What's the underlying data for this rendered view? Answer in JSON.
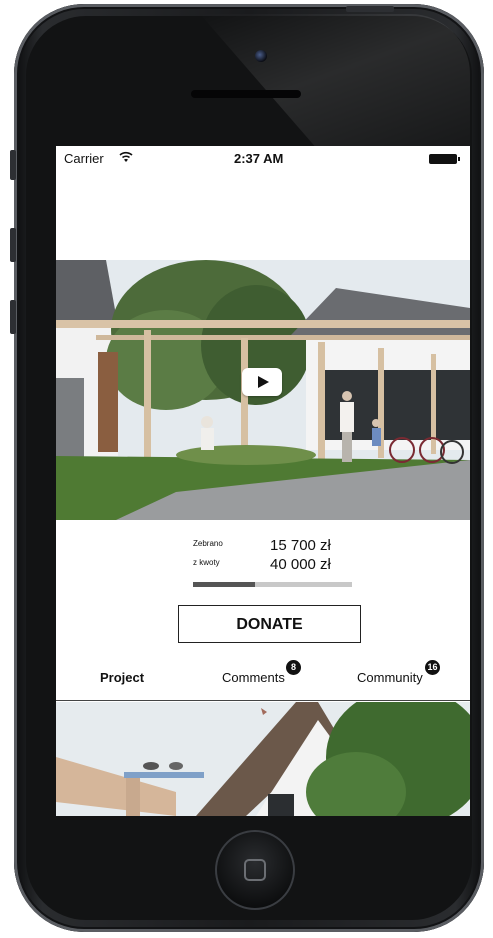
{
  "status_bar": {
    "carrier": "Carrier",
    "time": "2:37 AM"
  },
  "hero": {
    "play_icon": "play-icon"
  },
  "funding": {
    "raised_label": "Zebrano",
    "raised_amount": "15 700 zł",
    "goal_label": "z kwoty",
    "goal_amount": "40 000 zł",
    "progress_fraction": 0.39
  },
  "donate": {
    "label": "DONATE"
  },
  "tabs": [
    {
      "label": "Project",
      "active": true
    },
    {
      "label": "Comments",
      "badge": "8"
    },
    {
      "label": "Community",
      "badge": "16"
    }
  ],
  "colors": {
    "accent": "#111111",
    "progress_track": "#c8c8c8",
    "progress_fill": "#555555"
  }
}
